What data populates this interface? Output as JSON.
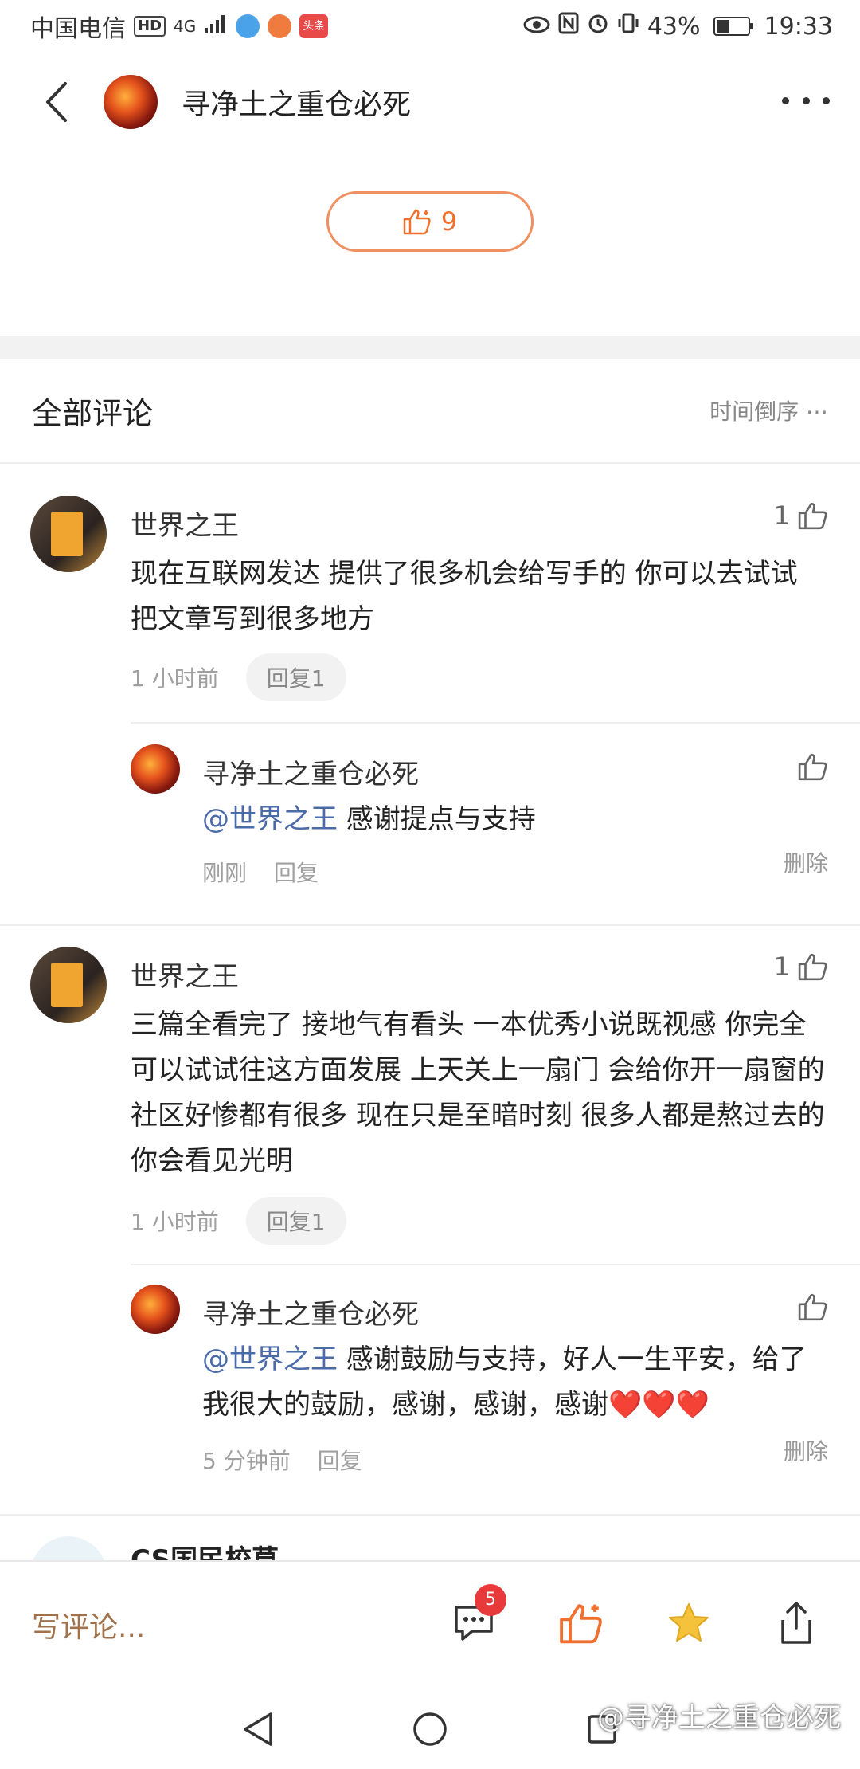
{
  "status_bar": {
    "carrier": "中国电信",
    "hd": "HD",
    "network": "4G",
    "battery": "43%",
    "battery_level": 0.43,
    "time": "19:33",
    "news_app_label": "头条"
  },
  "header": {
    "title": "寻净土之重仓必死"
  },
  "like": {
    "count": "9"
  },
  "comments_section": {
    "title": "全部评论",
    "sort_label": "时间倒序 ⋯"
  },
  "comments": [
    {
      "author": "世界之王",
      "likes": "1",
      "text": "现在互联网发达 提供了很多机会给写手的 你可以去试试 把文章写到很多地方",
      "time": "1 小时前",
      "reply_chip": "回复1",
      "reply": {
        "author": "寻净土之重仓必死",
        "mention": "@世界之王",
        "text": " 感谢提点与支持",
        "time": "刚刚",
        "reply_label": "回复",
        "delete_label": "删除"
      }
    },
    {
      "author": "世界之王",
      "likes": "1",
      "text": "三篇全看完了 接地气有看头 一本优秀小说既视感 你完全可以试试往这方面发展 上天关上一扇门 会给你开一扇窗的 社区好惨都有很多 现在只是至暗时刻 很多人都是熬过去的 你会看见光明",
      "time": "1 小时前",
      "reply_chip": "回复1",
      "reply": {
        "author": "寻净土之重仓必死",
        "mention": "@世界之王",
        "text": " 感谢鼓励与支持，好人一生平安，给了我很大的鼓励，感谢，感谢，感谢❤️❤️❤️",
        "time": "5 分钟前",
        "reply_label": "回复",
        "delete_label": "删除"
      }
    }
  ],
  "partial_comment": {
    "author": "CS国民校草"
  },
  "bottom_bar": {
    "write_placeholder": "写评论...",
    "comment_count": "5"
  },
  "watermark": "@寻净土之重仓必死",
  "colors": {
    "accent": "#f07030",
    "mention": "#4a6aa8",
    "badge": "#e83a3a",
    "star": "#f5c33b"
  }
}
